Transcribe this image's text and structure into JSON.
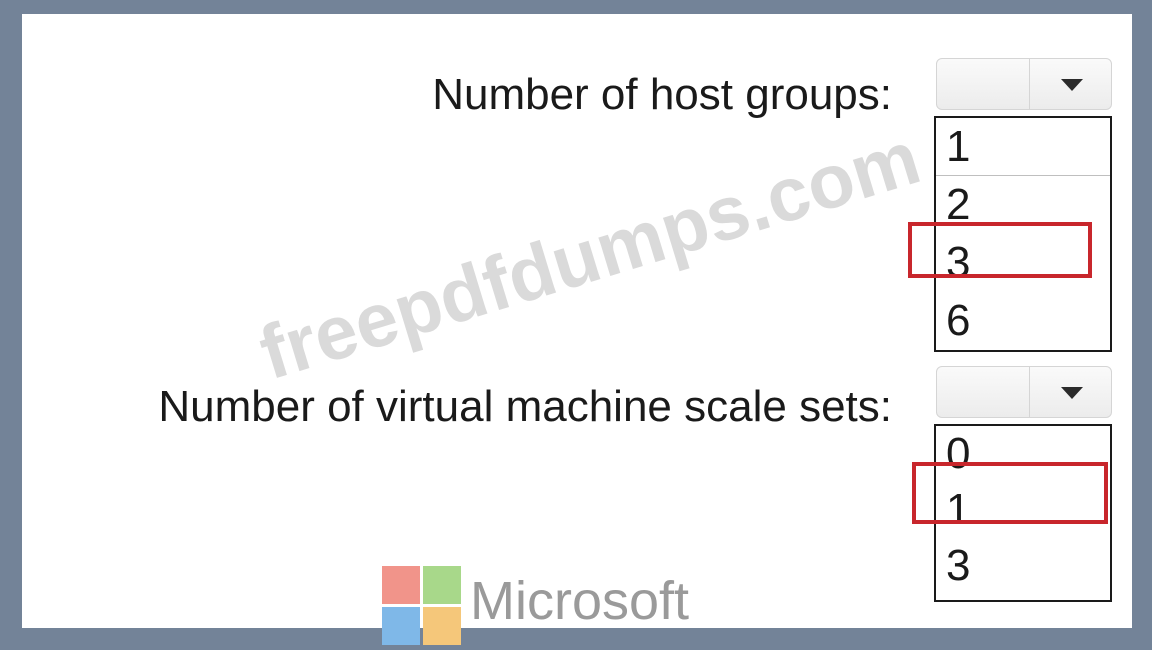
{
  "host_groups": {
    "label": "Number of host groups:",
    "selected": "",
    "options": [
      "1",
      "2",
      "3",
      "6"
    ],
    "highlighted": "3"
  },
  "vm_scale_sets": {
    "label": "Number of virtual machine scale sets:",
    "selected": "",
    "options": [
      "0",
      "1",
      "3"
    ],
    "highlighted": "1"
  },
  "watermark": "freepdfdumps.com",
  "logo": {
    "text": "Microsoft"
  },
  "colors": {
    "frame": "#738398",
    "highlight": "#c8262c"
  },
  "icons": {
    "dropdown": "chevron-down-icon",
    "logo": "microsoft-logo-icon"
  }
}
